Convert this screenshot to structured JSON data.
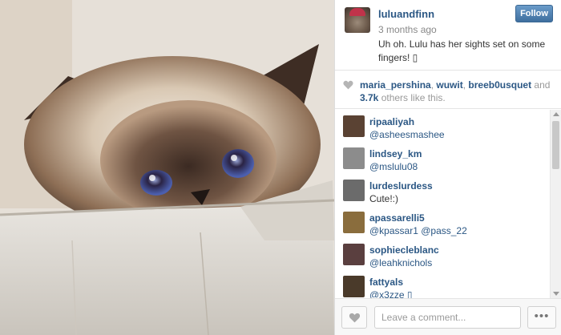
{
  "post": {
    "owner": "luluandfinn",
    "time": "3 months ago",
    "caption": "Uh oh. Lulu has her sights set on some fingers! ▯",
    "follow_label": "Follow"
  },
  "likes": {
    "users": [
      "maria_pershina",
      "wuwit",
      "breeb0usquet"
    ],
    "sep1": ", ",
    "sep2": ", ",
    "and_text": " and ",
    "others_count": "3.7k",
    "others_text": " others like this."
  },
  "comments": [
    {
      "user": "ripaaliyah",
      "text": "@asheesmashee",
      "mention": true,
      "avatar": "#5a4233"
    },
    {
      "user": "lindsey_km",
      "text": "@mslulu08",
      "mention": true,
      "avatar": "#8c8c8c"
    },
    {
      "user": "lurdeslurdess",
      "text": "Cute!:)",
      "mention": false,
      "avatar": "#6b6b6b"
    },
    {
      "user": "apassarelli5",
      "text": "@kpassar1 @pass_22",
      "mention": true,
      "avatar": "#8a6d3d"
    },
    {
      "user": "sophiecleblanc",
      "text": "@leahknichols",
      "mention": true,
      "avatar": "#5a3f3f"
    },
    {
      "user": "fattyals",
      "text": "@x3zze ▯",
      "mention": true,
      "avatar": "#4a3a2a"
    }
  ],
  "footer": {
    "comment_placeholder": "Leave a comment...",
    "more_label": "•••"
  },
  "icons": {
    "like": "heart-icon",
    "more": "ellipsis-icon"
  },
  "colors": {
    "link": "#2b5784",
    "follow": "#4f7fae"
  }
}
